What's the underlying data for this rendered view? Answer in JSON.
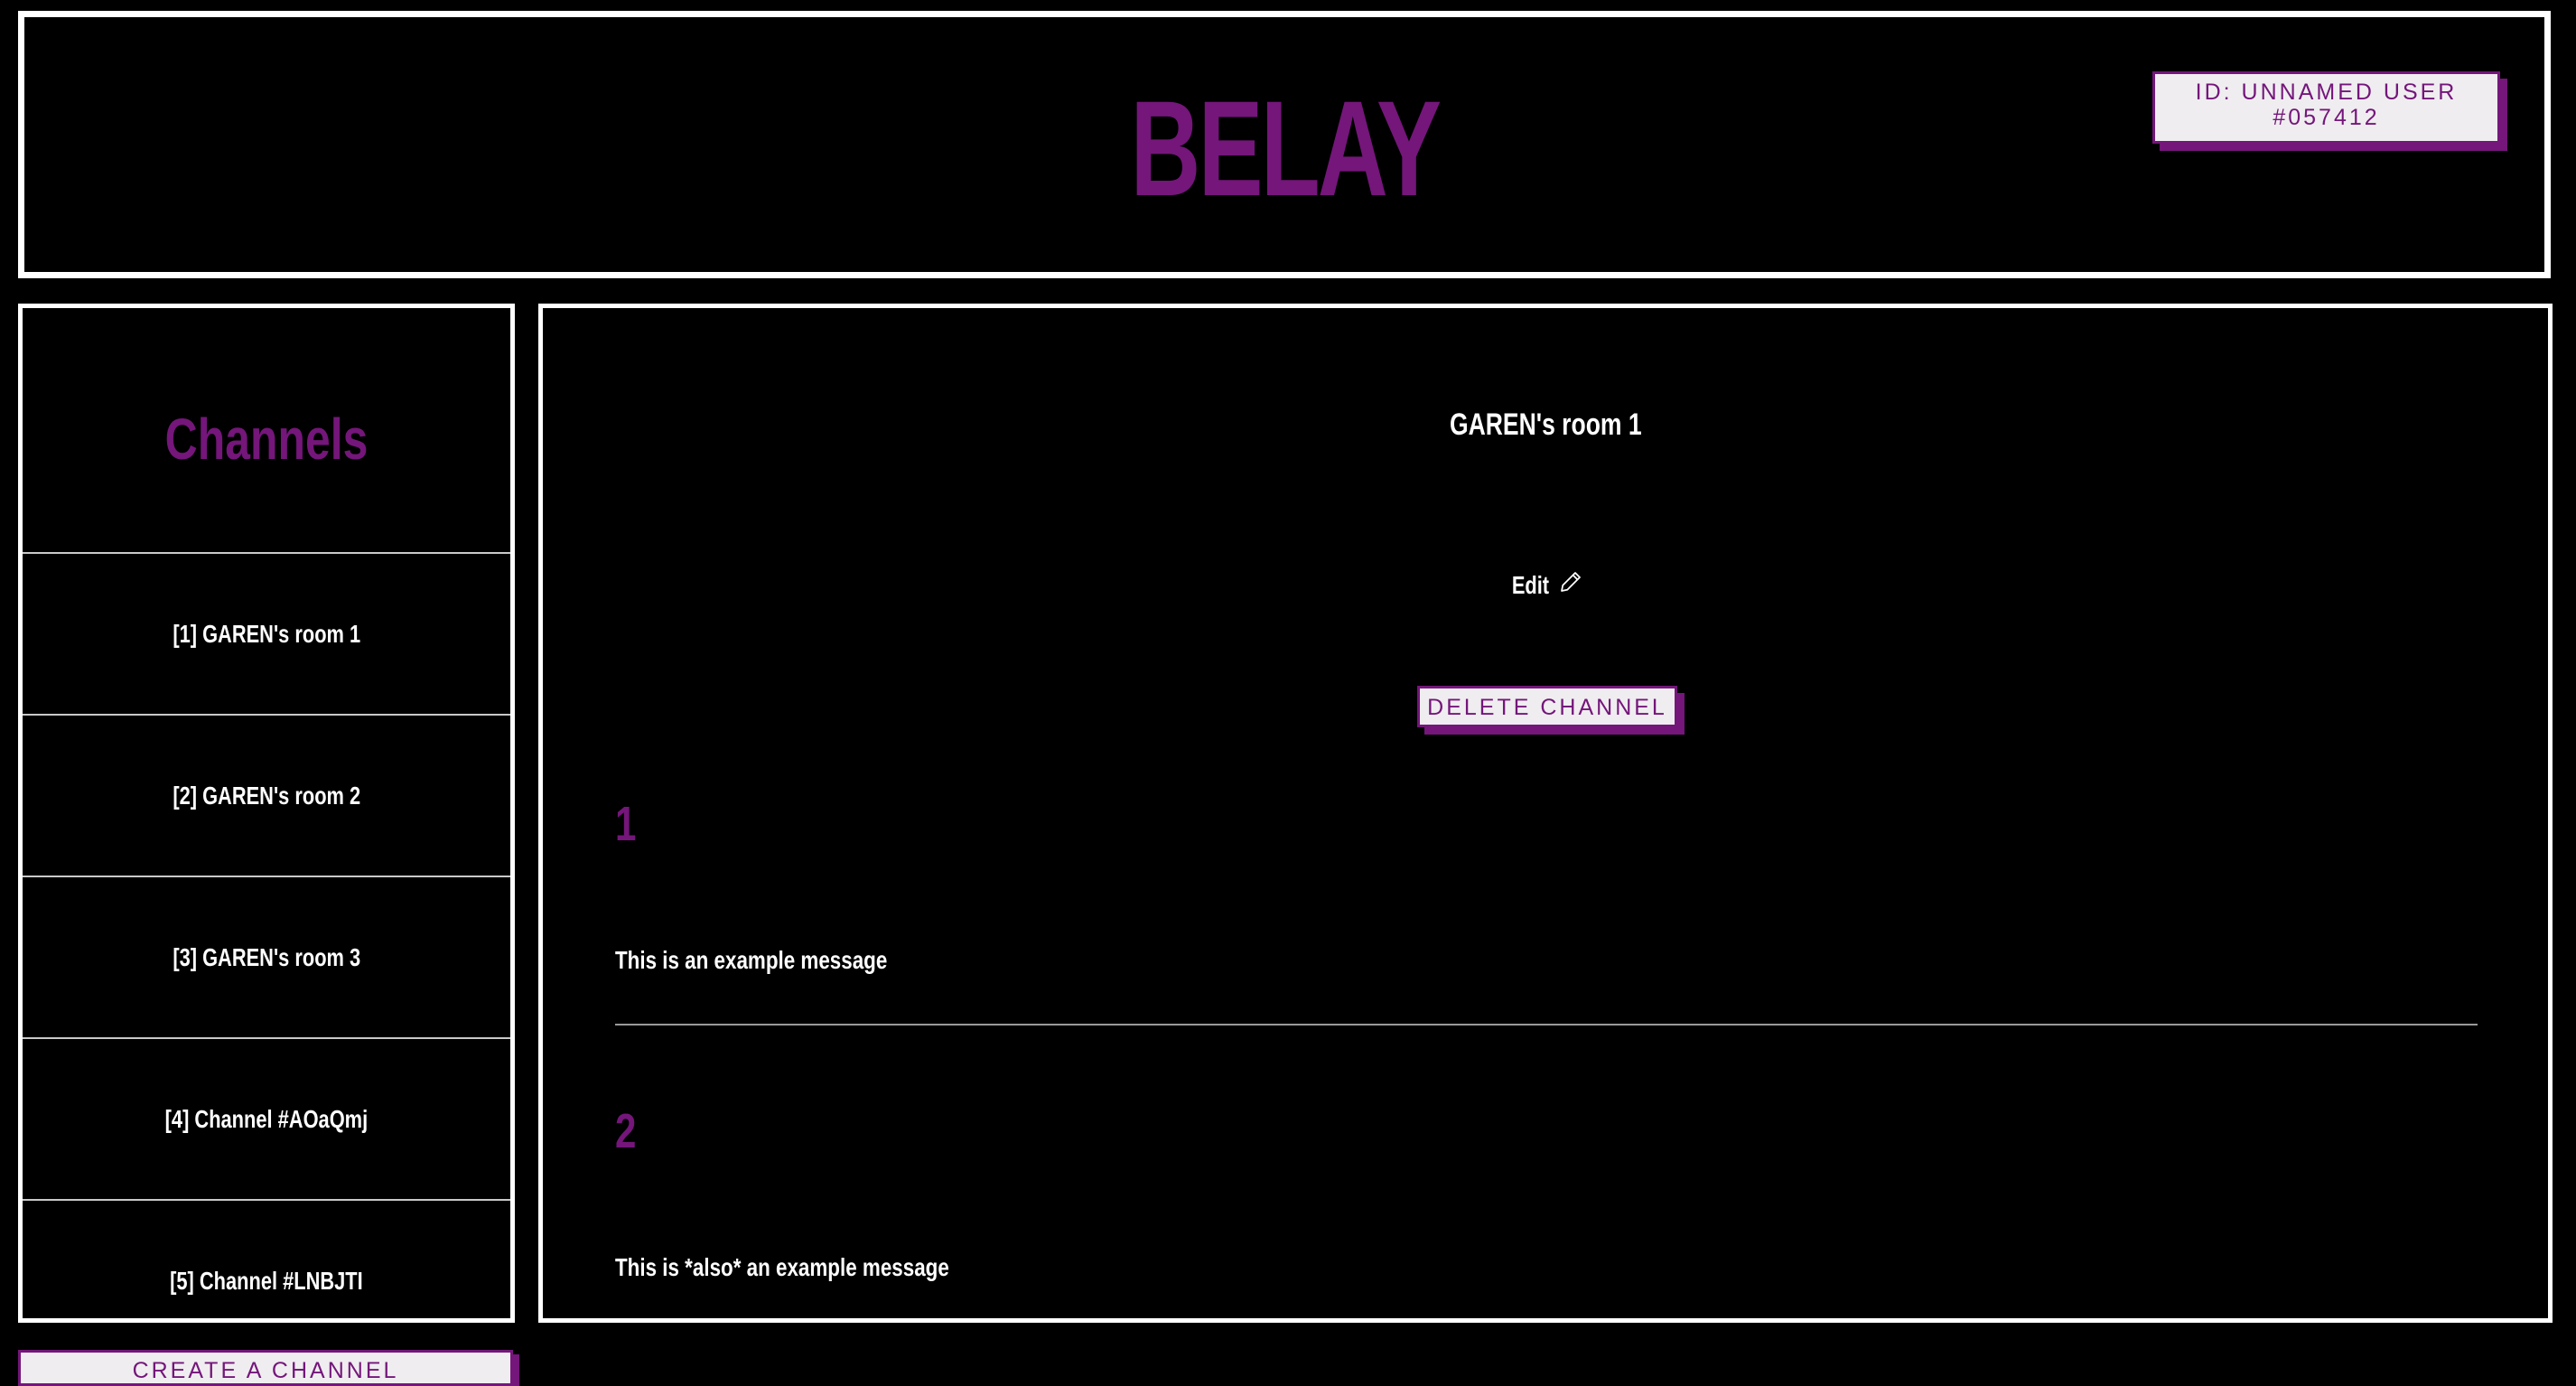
{
  "header": {
    "title": "BELAY",
    "user_id_label": "ID: UNNAMED USER #057412"
  },
  "sidebar": {
    "title": "Channels",
    "items": [
      {
        "label": "[1] GAREN's room 1"
      },
      {
        "label": "[2] GAREN's room 2"
      },
      {
        "label": "[3] GAREN's room 3"
      },
      {
        "label": "[4] Channel #AOaQmj"
      },
      {
        "label": "[5] Channel #LNBJTI"
      }
    ],
    "create_button_label": "CREATE A CHANNEL"
  },
  "main": {
    "room_title": "GAREN's room 1",
    "edit_label": "Edit",
    "edit_icon": "pencil-icon",
    "delete_button_label": "DELETE CHANNEL",
    "messages": [
      {
        "author": "1",
        "text": "This is an example message"
      },
      {
        "author": "2",
        "text": "This is *also* an example message"
      }
    ]
  },
  "colors": {
    "background": "#000000",
    "accent": "#74167a",
    "button_bg": "#efedf0",
    "border": "#ffffff"
  }
}
